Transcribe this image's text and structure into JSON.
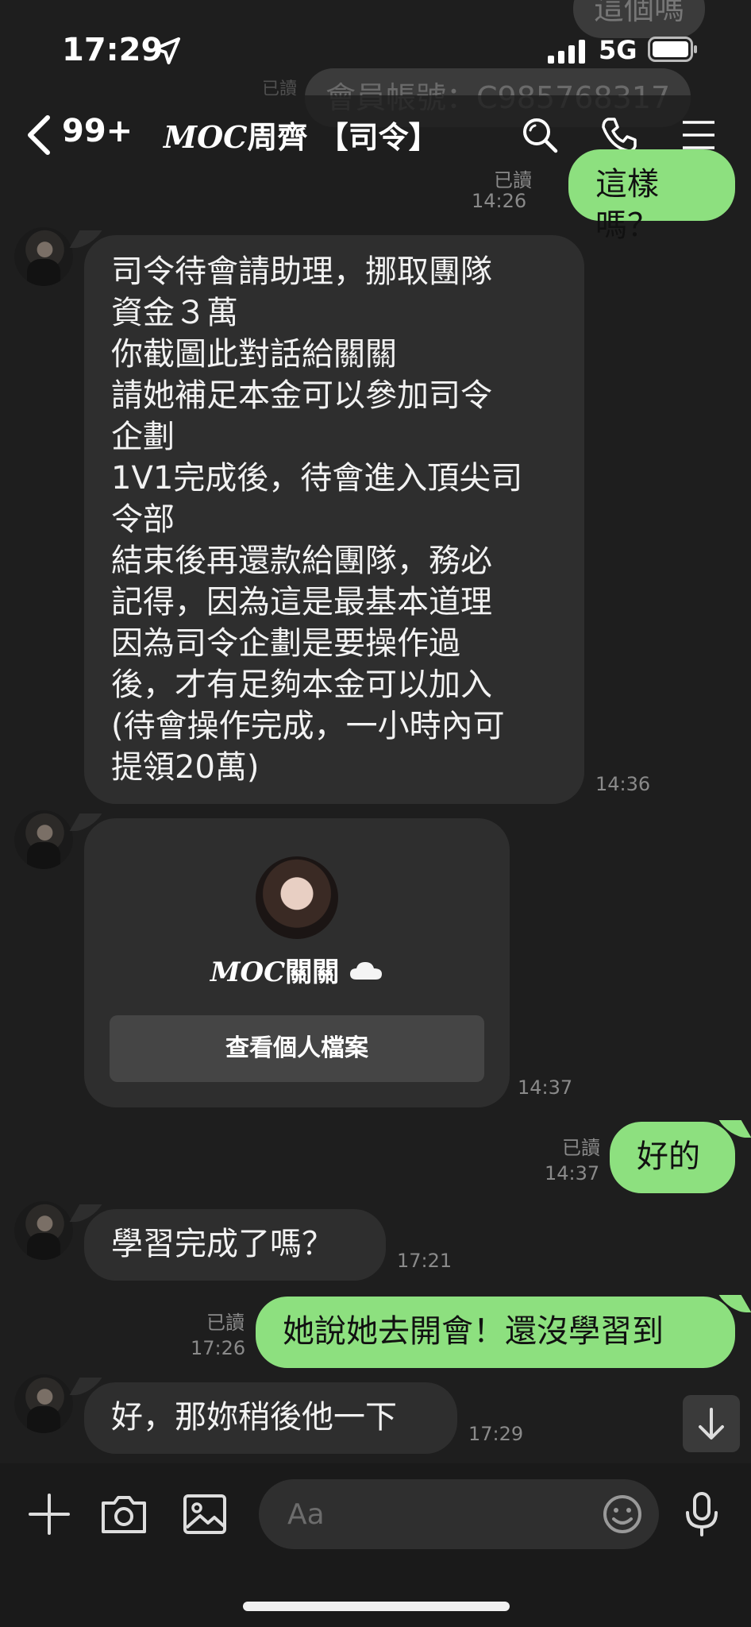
{
  "status_bar": {
    "time": "17:29",
    "network": "5G"
  },
  "background_messages": [
    {
      "text": "這個嗎"
    },
    {
      "read": "已讀",
      "text": "會員帳號：C985768317"
    }
  ],
  "header": {
    "back_count": "99+",
    "title_brand": "MOC",
    "title_rest": "周齊 【司令】"
  },
  "messages": [
    {
      "read": "已讀",
      "time": "14:26",
      "text": "這樣嗎？"
    },
    {
      "time": "14:36",
      "text": "司令待會請助理，挪取團隊\n資金３萬\n你截圖此對話給關關\n請她補足本金可以參加司令\n企劃\n1V1完成後，待會進入頂尖司\n令部\n結束後再還款給團隊，務必\n記得，因為這是最基本道理\n因為司令企劃是要操作過\n後，才有足夠本金可以加入\n(待會操作完成，一小時內可\n提領20萬)"
    },
    {
      "time": "14:37",
      "card_brand": "MOC",
      "card_name": "關關",
      "card_button": "查看個人檔案"
    },
    {
      "read": "已讀",
      "time": "14:37",
      "text": "好的"
    },
    {
      "time": "17:21",
      "text": "學習完成了嗎？"
    },
    {
      "read": "已讀",
      "time": "17:26",
      "text": "她說她去開會！還沒學習到"
    },
    {
      "time": "17:29",
      "text": "好，那妳稍後他一下"
    }
  ],
  "input": {
    "placeholder": "Aa"
  },
  "colors": {
    "background": "#1e1e1e",
    "incoming": "#2e2e2e",
    "outgoing": "#8de07f",
    "meta": "#8a8a8a"
  },
  "icons": [
    "location-arrow-icon",
    "signal-icon",
    "battery-icon",
    "chevron-left-icon",
    "search-icon",
    "phone-icon",
    "menu-icon",
    "cloud-icon",
    "arrow-down-icon",
    "plus-icon",
    "camera-icon",
    "image-icon",
    "emoji-icon",
    "microphone-icon"
  ]
}
